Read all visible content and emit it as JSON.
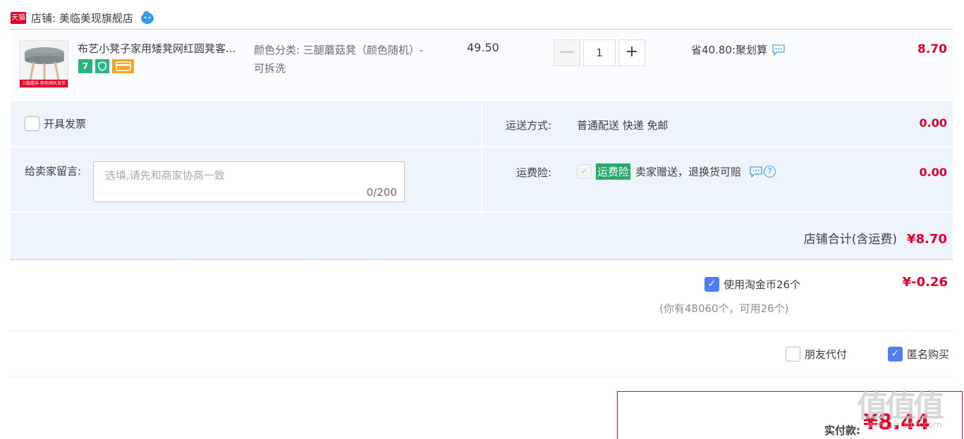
{
  "shop": {
    "logo_text": "天猫",
    "name": "店铺: 美临美现旗舰店"
  },
  "item": {
    "thumb_banner": "三腿蘑菇 颜色随机发货",
    "title": "布艺小凳子家用矮凳网红圆凳客...",
    "badge_seven": "7",
    "sku": "颜色分类: 三腿蘑菇凳（颜色随机）-可拆洗",
    "unit_price": "49.50",
    "qty_minus": "—",
    "quantity": "1",
    "qty_plus": "+",
    "promo": "省40.80:聚划算",
    "total": "8.70"
  },
  "options": {
    "invoice_label": "开具发票",
    "ship_label": "运送方式:",
    "ship_value": "普通配送 快递 免邮",
    "ship_fee": "0.00",
    "memo_label": "给卖家留言:",
    "memo_placeholder": "选填,请先和商家协商一致",
    "memo_count": "0/200",
    "insurance_label": "运费险:",
    "insurance_tag": "运费险",
    "insurance_desc": "卖家赠送，退换货可赔",
    "insurance_help": "?",
    "insurance_fee": "0.00",
    "shop_total_label": "店铺合计(含运费)",
    "shop_total_value": "¥8.70"
  },
  "coins": {
    "label": "使用淘金币26个",
    "note": "(你有48060个，可用26个)",
    "value": "¥-0.26"
  },
  "pay_options": {
    "friend_label": "朋友代付",
    "anon_label": "匿名购买"
  },
  "payment": {
    "label": "实付款:",
    "value": "¥8.44"
  },
  "watermark": {
    "text": "值值值",
    "sub": "www.smzdm.com"
  },
  "colors": {
    "accent_red": "#e4002b",
    "checkbox_blue": "#4f7df3",
    "panel_bg": "#eef4fc"
  },
  "icons": [
    "tmall-logo",
    "wangwang-icon",
    "chat-icon",
    "help-icon",
    "check-icon"
  ]
}
